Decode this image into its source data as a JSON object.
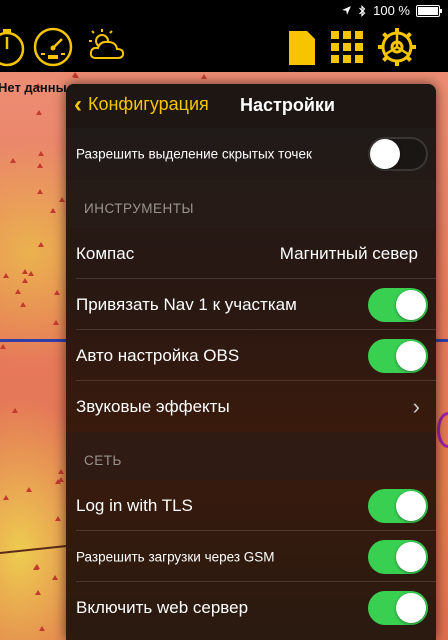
{
  "status": {
    "battery_text": "100 %",
    "battery_level": 1.0,
    "icons": [
      "location-arrow-icon",
      "bluetooth-icon",
      "battery-icon"
    ]
  },
  "toolbar": {
    "left_icons": [
      "timer-gauge-icon",
      "speedometer-icon",
      "weather-sun-cloud-icon"
    ],
    "right_icons": [
      "document-icon",
      "grid-menu-icon",
      "settings-gear-icon"
    ],
    "accent": "#f6c500"
  },
  "map": {
    "label": "Нет данны"
  },
  "panel": {
    "back_label": "Конфигурация",
    "title": "Настройки",
    "rows": {
      "hidden_points": {
        "label": "Разрешить выделение скрытых точек",
        "on": false
      },
      "compass": {
        "label": "Компас",
        "value": "Магнитный север"
      },
      "nav1": {
        "label": "Привязать Nav 1 к участкам",
        "on": true
      },
      "obs": {
        "label": "Авто настройка OBS",
        "on": true
      },
      "sound": {
        "label": "Звуковые эффекты"
      },
      "tls": {
        "label": "Log in with TLS",
        "on": true
      },
      "gsm": {
        "label": "Разрешить загрузки через GSM",
        "on": true
      },
      "web": {
        "label": "Включить web сервер",
        "on": true
      }
    },
    "sections": {
      "instruments": "ИНСТРУМЕНТЫ",
      "network": "СЕТЬ"
    },
    "colors": {
      "toggle_on": "#39d052",
      "back_accent": "#f6c500"
    }
  }
}
